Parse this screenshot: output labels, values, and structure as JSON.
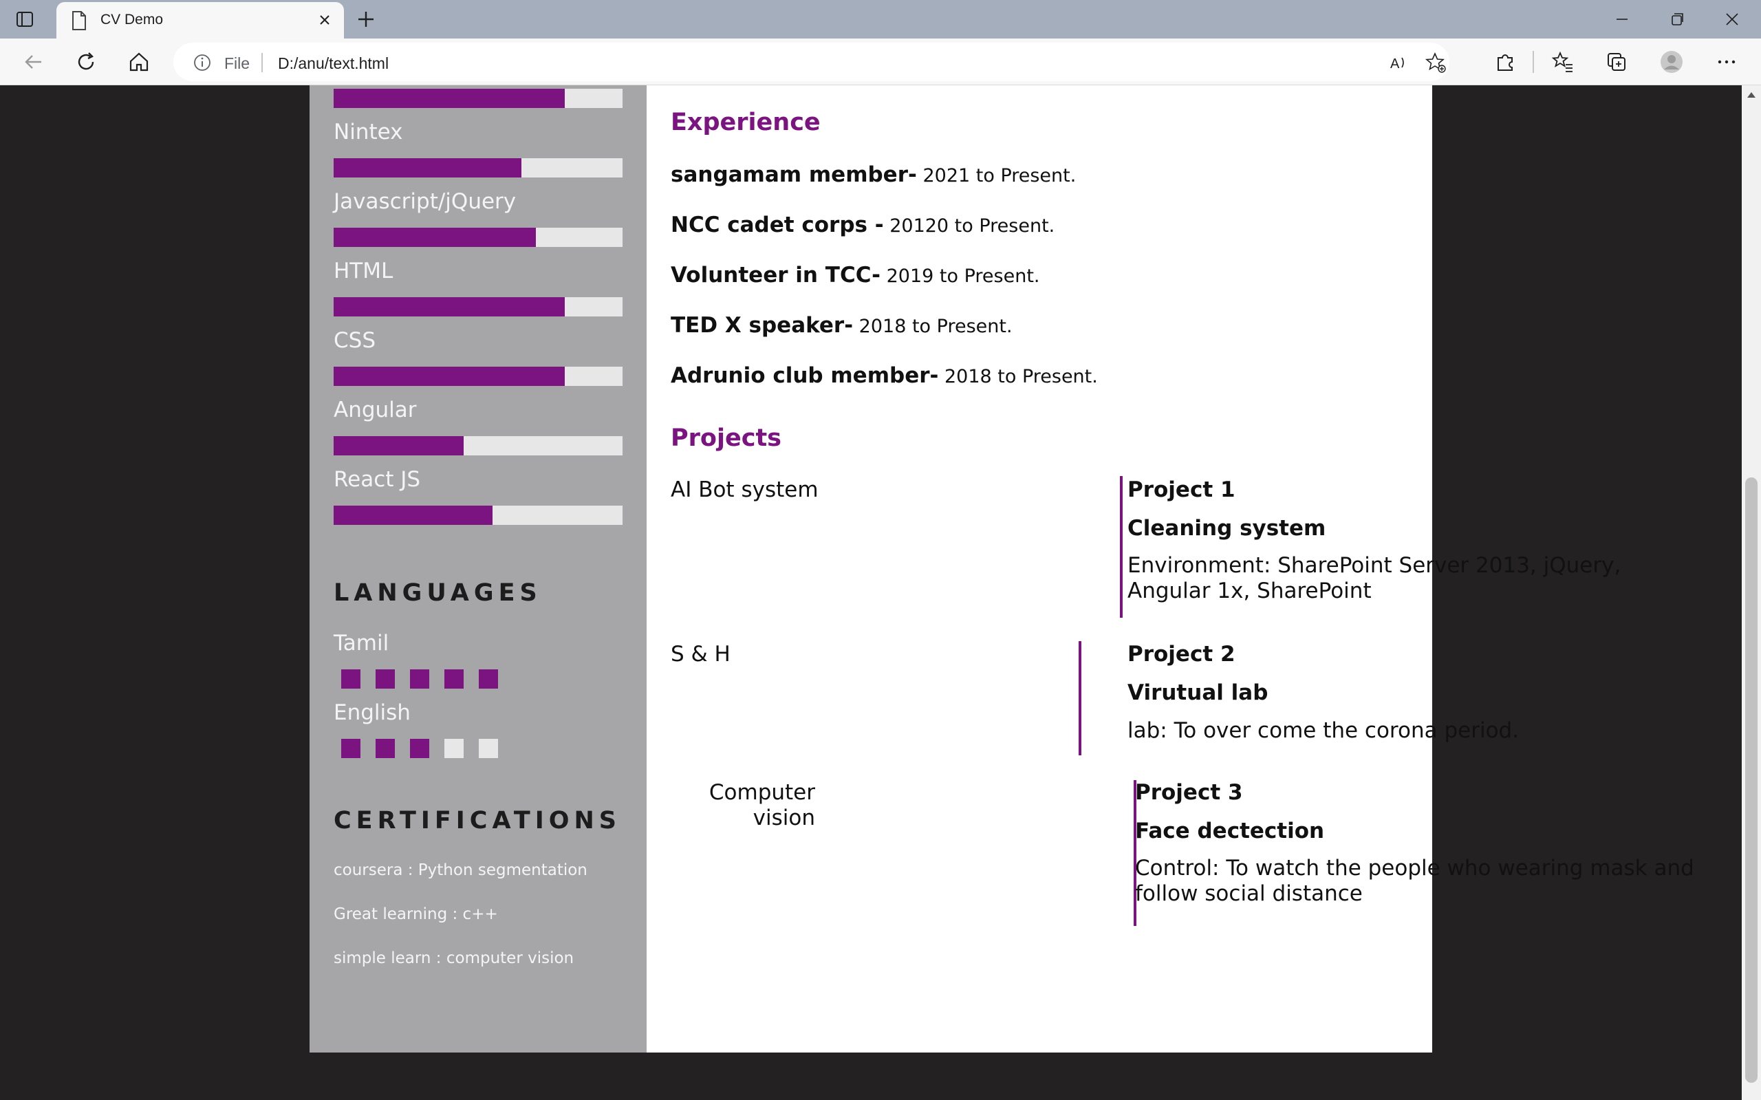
{
  "browser": {
    "tab_title": "CV Demo",
    "address_prefix": "File",
    "url": "D:/anu/text.html"
  },
  "skills": [
    {
      "label": "",
      "level": 0.8
    },
    {
      "label": "Nintex",
      "level": 0.65
    },
    {
      "label": "Javascript/jQuery",
      "level": 0.7
    },
    {
      "label": "HTML",
      "level": 0.8
    },
    {
      "label": "CSS",
      "level": 0.8
    },
    {
      "label": "Angular",
      "level": 0.45
    },
    {
      "label": "React JS",
      "level": 0.55
    }
  ],
  "languages": {
    "heading": "LANGUAGES",
    "items": [
      {
        "label": "Tamil",
        "rating": 5,
        "max": 5
      },
      {
        "label": "English",
        "rating": 3,
        "max": 5
      }
    ]
  },
  "certifications": {
    "heading": "CERTIFICATIONS",
    "items": [
      "coursera : Python segmentation",
      "Great learning : c++",
      "simple learn : computer vision"
    ]
  },
  "experience": {
    "heading": "Experience",
    "items": [
      {
        "role": "sangamam member-",
        "period": " 2021 to Present."
      },
      {
        "role": "NCC cadet corps -",
        "period": " 20120 to Present."
      },
      {
        "role": "Volunteer in TCC-",
        "period": " 2019 to Present."
      },
      {
        "role": "TED X speaker-",
        "period": " 2018 to Present."
      },
      {
        "role": "Adrunio club member-",
        "period": " 2018 to Present."
      }
    ]
  },
  "projects": {
    "heading": "Projects",
    "items": [
      {
        "name": "AI Bot system",
        "number": "Project 1",
        "title": "Cleaning system",
        "desc": "Environment: SharePoint Server 2013, jQuery, Angular 1x, SharePoint"
      },
      {
        "name": "S & H",
        "number": "Project 2",
        "title": "Virutual lab",
        "desc": "lab: To over come the corona period."
      },
      {
        "name": "Computer vision",
        "number": "Project 3",
        "title": "Face dectection",
        "desc": "Control: To watch the people who wearing mask and follow social distance"
      }
    ]
  },
  "colors": {
    "accent": "#7b1380",
    "sidebar": "#a6a6a8",
    "bar_track": "#e7e7e7"
  }
}
